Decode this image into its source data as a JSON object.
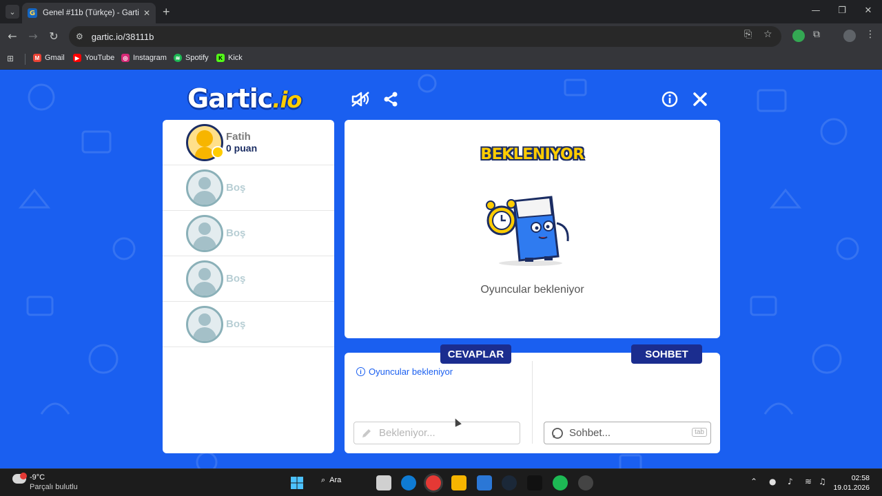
{
  "browser": {
    "tab_title": "Genel #11b (Türkçe) - Gartic.io",
    "tab_favicon": "G",
    "url": "gartic.io/38111b",
    "bookmarks": [
      {
        "label": "Gmail",
        "color": "#ea4335",
        "glyph": "M"
      },
      {
        "label": "YouTube",
        "color": "#ff0000",
        "glyph": "▶"
      },
      {
        "label": "Instagram",
        "color": "#d62976",
        "glyph": "◎"
      },
      {
        "label": "Spotify",
        "color": "#1db954",
        "glyph": "≋"
      },
      {
        "label": "Kick",
        "color": "#53fc18",
        "glyph": "K"
      }
    ]
  },
  "game": {
    "logo_main": "Gartic",
    "logo_suffix": ".io",
    "players": [
      {
        "name": "Fatih",
        "score": "0 puan",
        "is_me": true
      },
      {
        "name": "Boş"
      },
      {
        "name": "Boş"
      },
      {
        "name": "Boş"
      },
      {
        "name": "Boş"
      }
    ],
    "stage": {
      "title": "BEKLENIYOR",
      "message": "Oyuncular bekleniyor"
    },
    "answers": {
      "label": "CEVAPLAR",
      "info": "Oyuncular bekleniyor",
      "placeholder": "Bekleniyor..."
    },
    "chat": {
      "label": "SOHBET",
      "placeholder": "Sohbet...",
      "key_hint": "tab"
    },
    "colors": {
      "background": "#1a5ff0",
      "accent_dark": "#1b2d8f",
      "title_yellow": "#ffcc00"
    }
  },
  "taskbar": {
    "temperature": "-9°C",
    "condition": "Parçalı bulutlu",
    "search_label": "Ara",
    "time": "02:58",
    "date": "19.01.2026"
  }
}
